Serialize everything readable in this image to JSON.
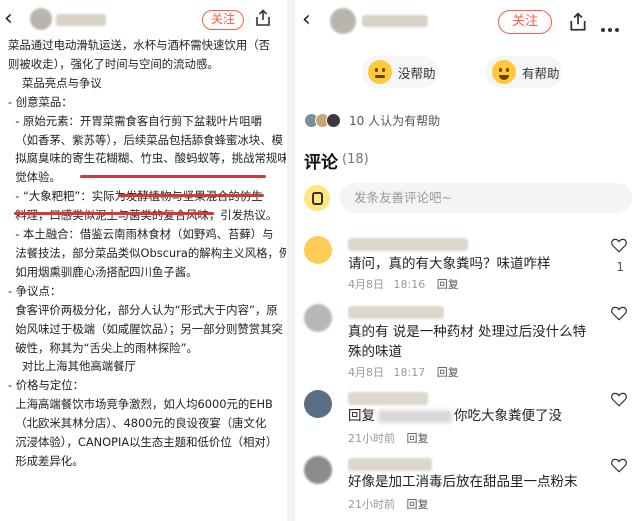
{
  "left": {
    "follow_label": "关注",
    "paragraphs": [
      "菜品通过电动滑轨运送，水杯与酒杯需快速饮用（否",
      "则被收走），强化了时间与空间的流动感。",
      "",
      "",
      "菜品亮点与争议",
      "- 创意菜品：",
      "  - 原始元素：开胃菜需食客自行剪下盆栽叶片咀嚼",
      "  （如香茅、紫苏等），后续菜品包括舔食蜂蜜冰块、模",
      "  拟腐臭味的寄生花糊糊、竹虫、酸蚂蚁等，挑战常规味",
      "  觉体验。",
      "  - “大象粑粑”：实际为发酵植物与坚果混合的仿生",
      "  料理，口感类似泥土与菌类的复合风味，引发热议。",
      "  - 本土融合：借鉴云南雨林食材（如野鸡、苔藓）与",
      "  法餐技法，部分菜品类似Obscura的解构主义风格，例",
      "  如用烟熏驯鹿心汤搭配四川鱼子酱。",
      "- 争议点：",
      "  食客评价两极分化，部分人认为“形式大于内容”，原",
      "  始风味过于极端（如咸腥饮品）；另一部分则赞赏其突",
      "  破性，称其为“舌尖上的雨林探险”。",
      "",
      "",
      "对比上海其他高端餐厅",
      "- 价格与定位：",
      "  上海高端餐饮市场竞争激烈，如人均6000元的EHB",
      "  （北欧米其林分店）、4800元的良设夜宴（唐文化",
      "  沉浸体验），CANOPIA以生态主题和低价位（相对）",
      "  形成差异化。"
    ]
  },
  "right": {
    "follow_label": "关注",
    "not_helpful_label": "没帮助",
    "helpful_label": "有帮助",
    "helpful_count_text": "10 人认为有帮助",
    "comments_title": "评论",
    "comments_count": "(18)",
    "input_placeholder": "发条友善评论吧~",
    "comments": [
      {
        "text": "请问，真的有大象粪吗？味道咋样",
        "time": "4月8日",
        "time2": "18:16",
        "reply": "回复",
        "likes": "1"
      },
      {
        "text": "真的有 说是一种药材 处理过后没什么特",
        "text2": "殊的味道",
        "time": "4月8日",
        "time2": "18:17",
        "reply": "回复",
        "likes": ""
      },
      {
        "text": "回复",
        "text_tail": "你吃大象粪便了没",
        "time": "21小时前",
        "time2": "",
        "reply": "回复",
        "likes": ""
      },
      {
        "text": "好像是加工消毒后放在甜品里一点粉末",
        "time": "21小时前",
        "time2": "",
        "reply": "回复",
        "likes": ""
      }
    ]
  },
  "colors": {
    "accent": "#ff5a45",
    "link": "#0066cc",
    "underline": "#d23a3a",
    "emoji": "#ffc93b"
  },
  "icons": [
    "back-icon",
    "share-icon",
    "more-icon",
    "heart-icon",
    "sad-face-icon",
    "happy-face-icon"
  ]
}
